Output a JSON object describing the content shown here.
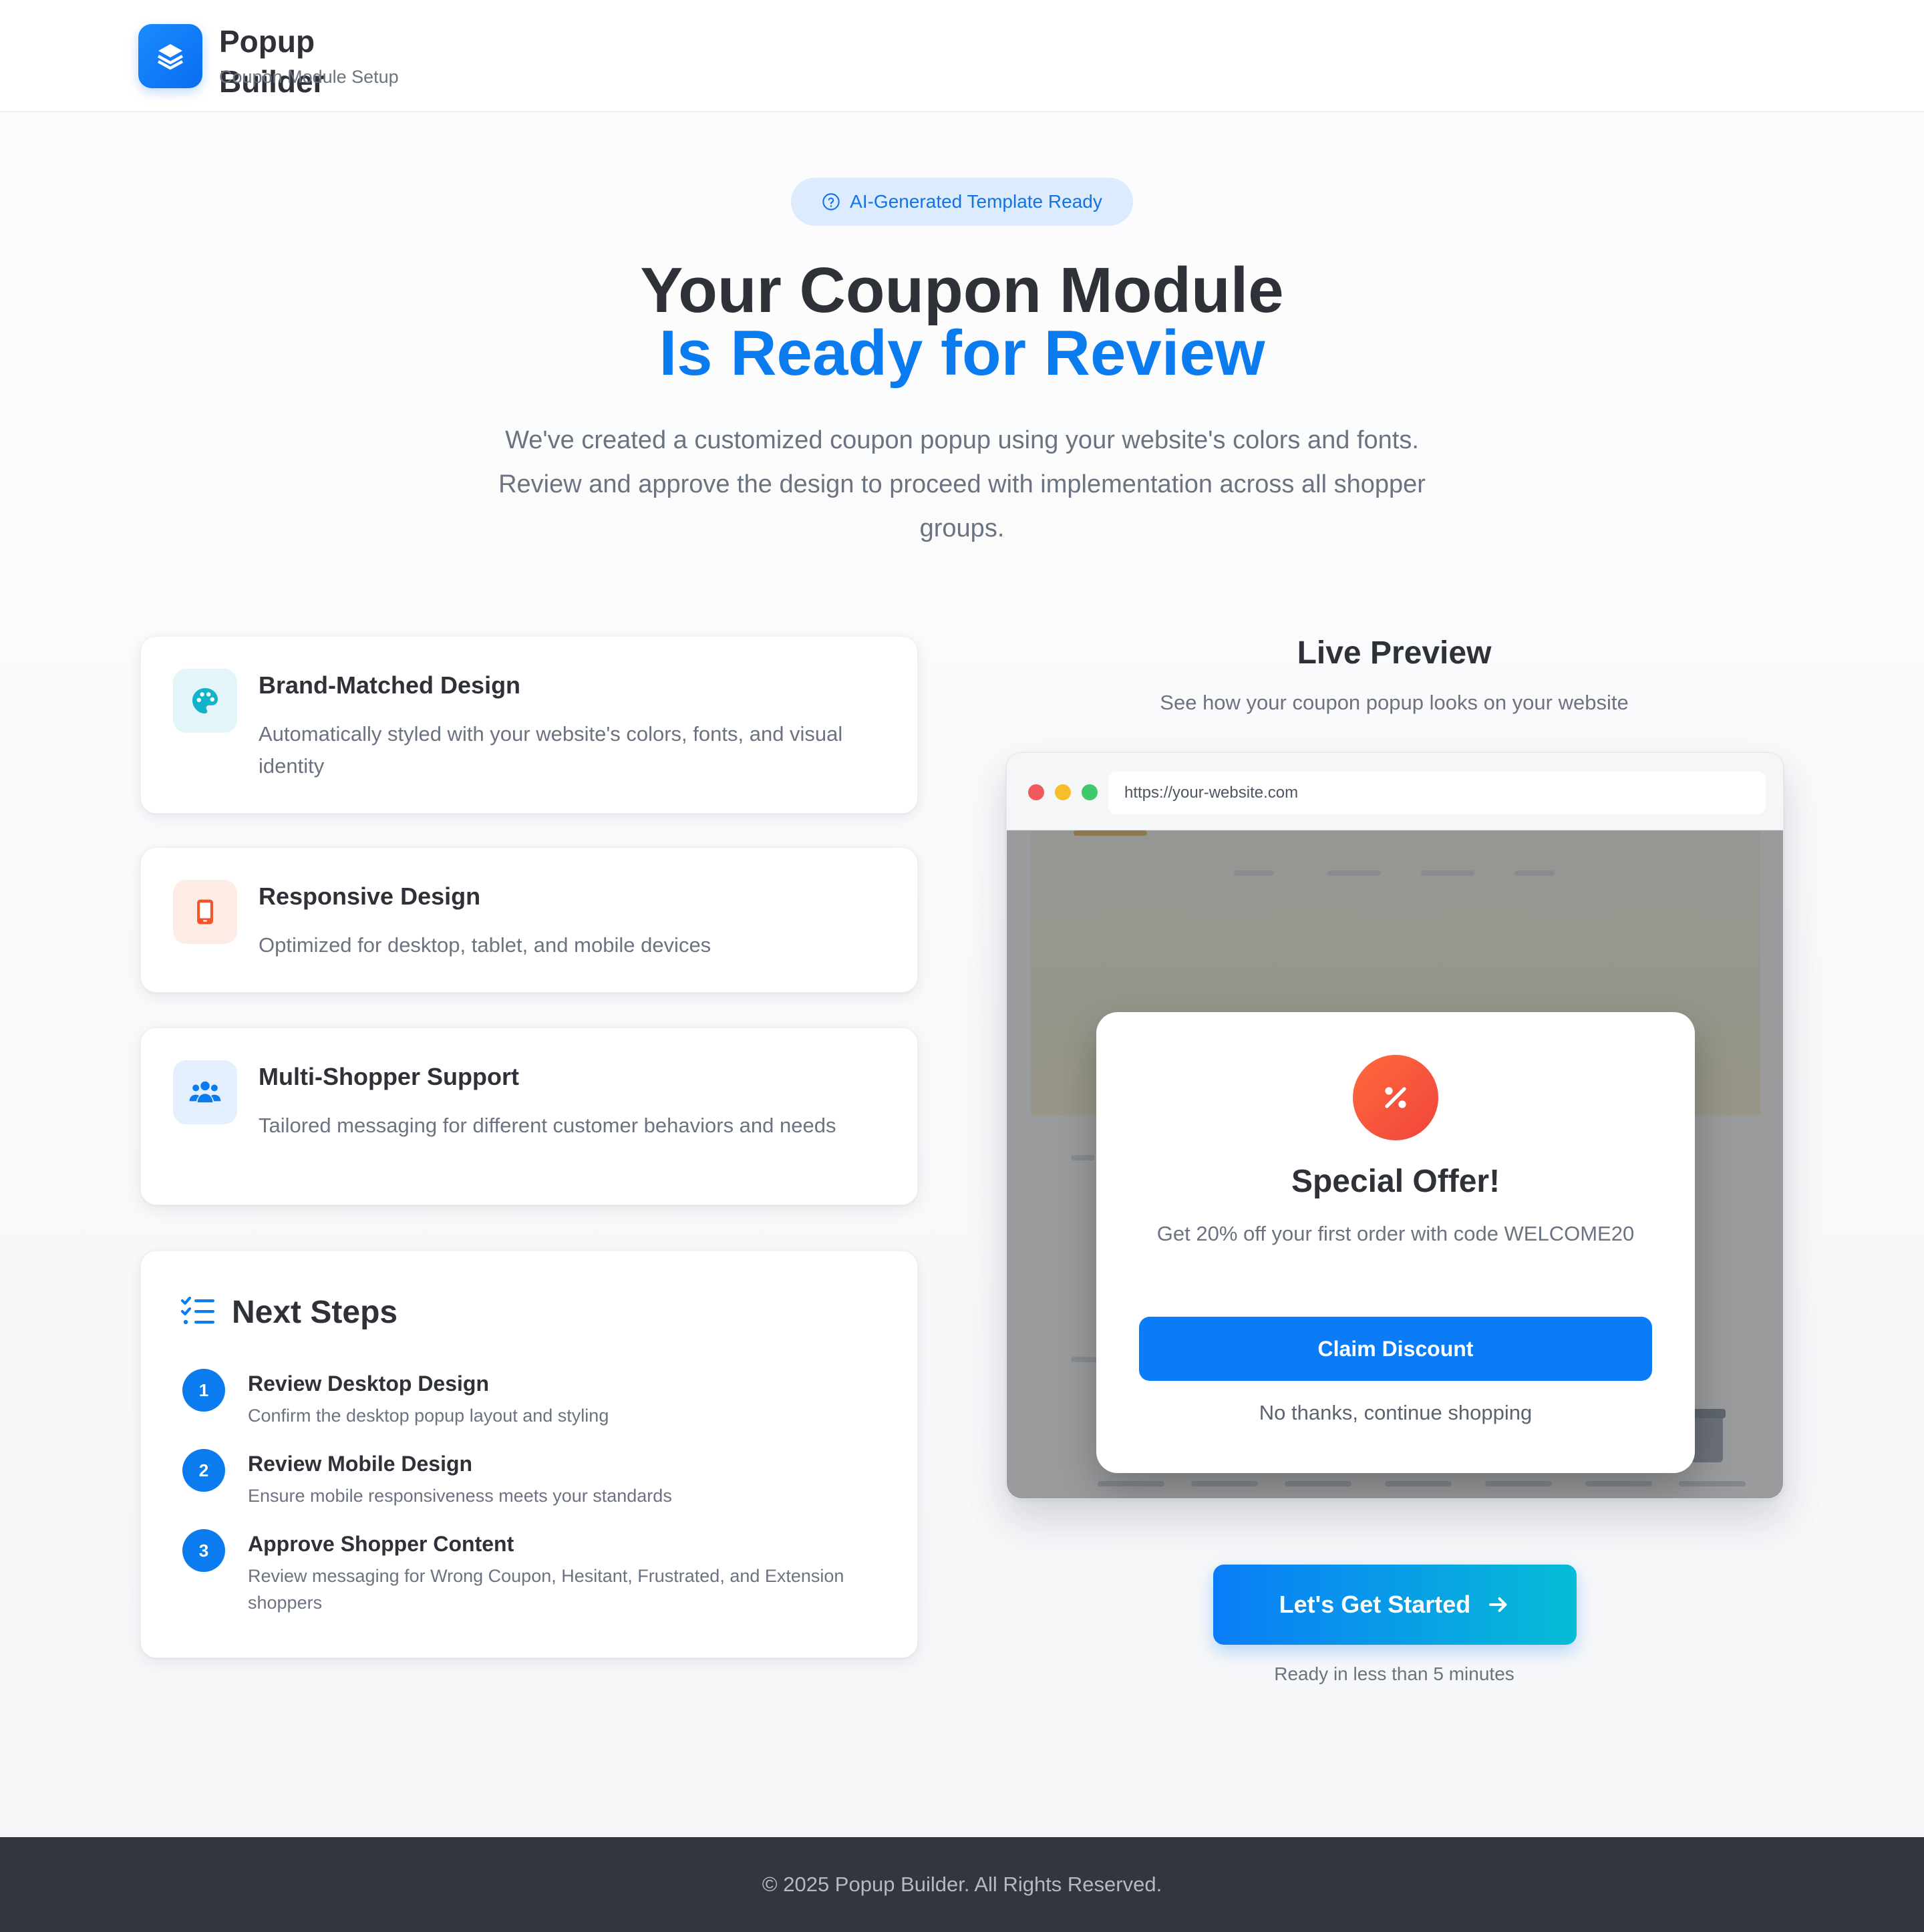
{
  "header": {
    "brand_title": "Popup Builder",
    "brand_subtitle": "Coupon Module Setup",
    "logo_icon": "layers-icon"
  },
  "hero": {
    "badge": "AI-Generated Template Ready",
    "title_line1": "Your Coupon Module",
    "title_line2": "Is Ready for Review",
    "description": "We've created a customized coupon popup using your website's colors and fonts. Review and approve the design to proceed with implementation across all shopper groups."
  },
  "features": [
    {
      "icon": "palette-icon",
      "title": "Brand-Matched Design",
      "description": "Automatically styled with your website's colors, fonts, and visual identity"
    },
    {
      "icon": "tablet-icon",
      "title": "Responsive Design",
      "description": "Optimized for desktop, tablet, and mobile devices"
    },
    {
      "icon": "users-icon",
      "title": "Multi-Shopper Support",
      "description": "Tailored messaging for different customer behaviors and needs"
    }
  ],
  "next_steps": {
    "title": "Next Steps",
    "steps": [
      {
        "number": "1",
        "title": "Review Desktop Design",
        "description": "Confirm the desktop popup layout and styling"
      },
      {
        "number": "2",
        "title": "Review Mobile Design",
        "description": "Ensure mobile responsiveness meets your standards"
      },
      {
        "number": "3",
        "title": "Approve Shopper Content",
        "description": "Review messaging for Wrong Coupon, Hesitant, Frustrated, and Extension shoppers"
      }
    ]
  },
  "preview": {
    "title": "Live Preview",
    "subtitle": "See how your coupon popup looks on your website",
    "url": "https://your-website.com",
    "popup": {
      "icon": "percent-icon",
      "title": "Special Offer!",
      "description": "Get 20% off your first order with code WELCOME20",
      "claim_button": "Claim Discount",
      "dismiss_link": "No thanks, continue shopping"
    }
  },
  "cta": {
    "button": "Let's Get Started",
    "note": "Ready in less than 5 minutes"
  },
  "footer": {
    "copyright": "© 2025 Popup Builder. All Rights Reserved."
  },
  "colors": {
    "primary": "#0a7cf0",
    "text_dark": "#2e3138",
    "text_muted": "#6b7280",
    "footer_bg": "#33363d",
    "popup_icon": "#f0443c"
  }
}
